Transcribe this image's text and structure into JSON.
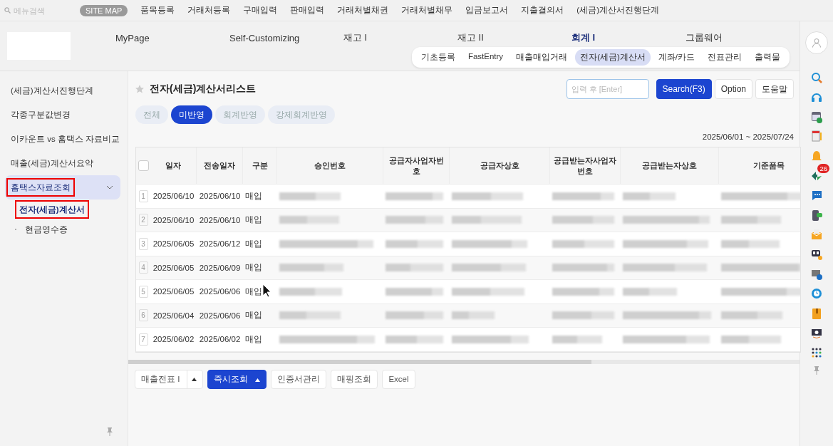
{
  "top_bar": {
    "search_placeholder": "메뉴검색",
    "sitemap": "SITE MAP",
    "links": [
      "품목등록",
      "거래처등록",
      "구매입력",
      "판매입력",
      "거래처별채권",
      "거래처별채무",
      "입금보고서",
      "지출결의서",
      "(세금)계산서진행단계"
    ]
  },
  "main_menu": [
    {
      "label": "MyPage",
      "selected": false
    },
    {
      "label": "Self-Customizing",
      "selected": false
    },
    {
      "label": "재고 I",
      "selected": false
    },
    {
      "label": "재고 II",
      "selected": false
    },
    {
      "label": "회계 I",
      "selected": true
    },
    {
      "label": "그룹웨어",
      "selected": false
    }
  ],
  "sub_menu": [
    {
      "label": "기초등록",
      "selected": false
    },
    {
      "label": "FastEntry",
      "selected": false
    },
    {
      "label": "매출매입거래",
      "selected": false
    },
    {
      "label": "전자(세금)계산서",
      "selected": true
    },
    {
      "label": "계좌/카드",
      "selected": false
    },
    {
      "label": "전표관리",
      "selected": false
    },
    {
      "label": "출력물",
      "selected": false
    }
  ],
  "sidebar": {
    "items": [
      {
        "label": "(세금)계산서진행단계",
        "selected": false,
        "highlighted": false
      },
      {
        "label": "각종구분값변경",
        "selected": false,
        "highlighted": false
      },
      {
        "label": "이카운트 vs 홈택스 자료비교",
        "selected": false,
        "highlighted": false
      },
      {
        "label": "매출(세금)계산서요약",
        "selected": false,
        "highlighted": false
      },
      {
        "label": "홈택스자료조회",
        "selected": true,
        "highlighted": true,
        "expanded": true,
        "children": [
          {
            "label": "전자(세금)계산서",
            "selected": true,
            "highlighted": true
          },
          {
            "label": "현금영수증",
            "selected": false,
            "highlighted": false
          }
        ]
      }
    ]
  },
  "page": {
    "title": "전자(세금)계산서리스트",
    "search_placeholder": "입력 후 [Enter]",
    "buttons": [
      {
        "label": "Search(F3)",
        "kind": "primary"
      },
      {
        "label": "Option",
        "kind": "plain"
      },
      {
        "label": "도움말",
        "kind": "plain"
      }
    ],
    "filters": [
      {
        "label": "전체",
        "selected": false
      },
      {
        "label": "미반영",
        "selected": true
      },
      {
        "label": "회계반영",
        "selected": false
      },
      {
        "label": "강제회계반영",
        "selected": false
      }
    ],
    "date_range": "2025/06/01 ~ 2025/07/24"
  },
  "table": {
    "all_checked": false,
    "columns": [
      "일자",
      "전송일자",
      "구분",
      "승인번호",
      "공급자사업자번호",
      "공급자상호",
      "공급받는자사업자번호",
      "공급받는자상호",
      "기준품목"
    ],
    "rows": [
      {
        "no": "1",
        "date": "2025/06/10",
        "sent_date": "2025/06/10",
        "type": "매입"
      },
      {
        "no": "2",
        "date": "2025/06/10",
        "sent_date": "2025/06/10",
        "type": "매입"
      },
      {
        "no": "3",
        "date": "2025/06/05",
        "sent_date": "2025/06/12",
        "type": "매입"
      },
      {
        "no": "4",
        "date": "2025/06/05",
        "sent_date": "2025/06/09",
        "type": "매입"
      },
      {
        "no": "5",
        "date": "2025/06/05",
        "sent_date": "2025/06/06",
        "type": "매입"
      },
      {
        "no": "6",
        "date": "2025/06/04",
        "sent_date": "2025/06/06",
        "type": "매입"
      },
      {
        "no": "7",
        "date": "2025/06/02",
        "sent_date": "2025/06/02",
        "type": "매입"
      }
    ]
  },
  "bottom_buttons": [
    {
      "label": "매출전표 I",
      "kind": "split"
    },
    {
      "label": "즉시조회",
      "kind": "primary-split"
    },
    {
      "label": "인증서관리",
      "kind": "plain"
    },
    {
      "label": "매핑조회",
      "kind": "plain"
    },
    {
      "label": "Excel",
      "kind": "plain"
    }
  ],
  "rail": {
    "badge": "26"
  }
}
